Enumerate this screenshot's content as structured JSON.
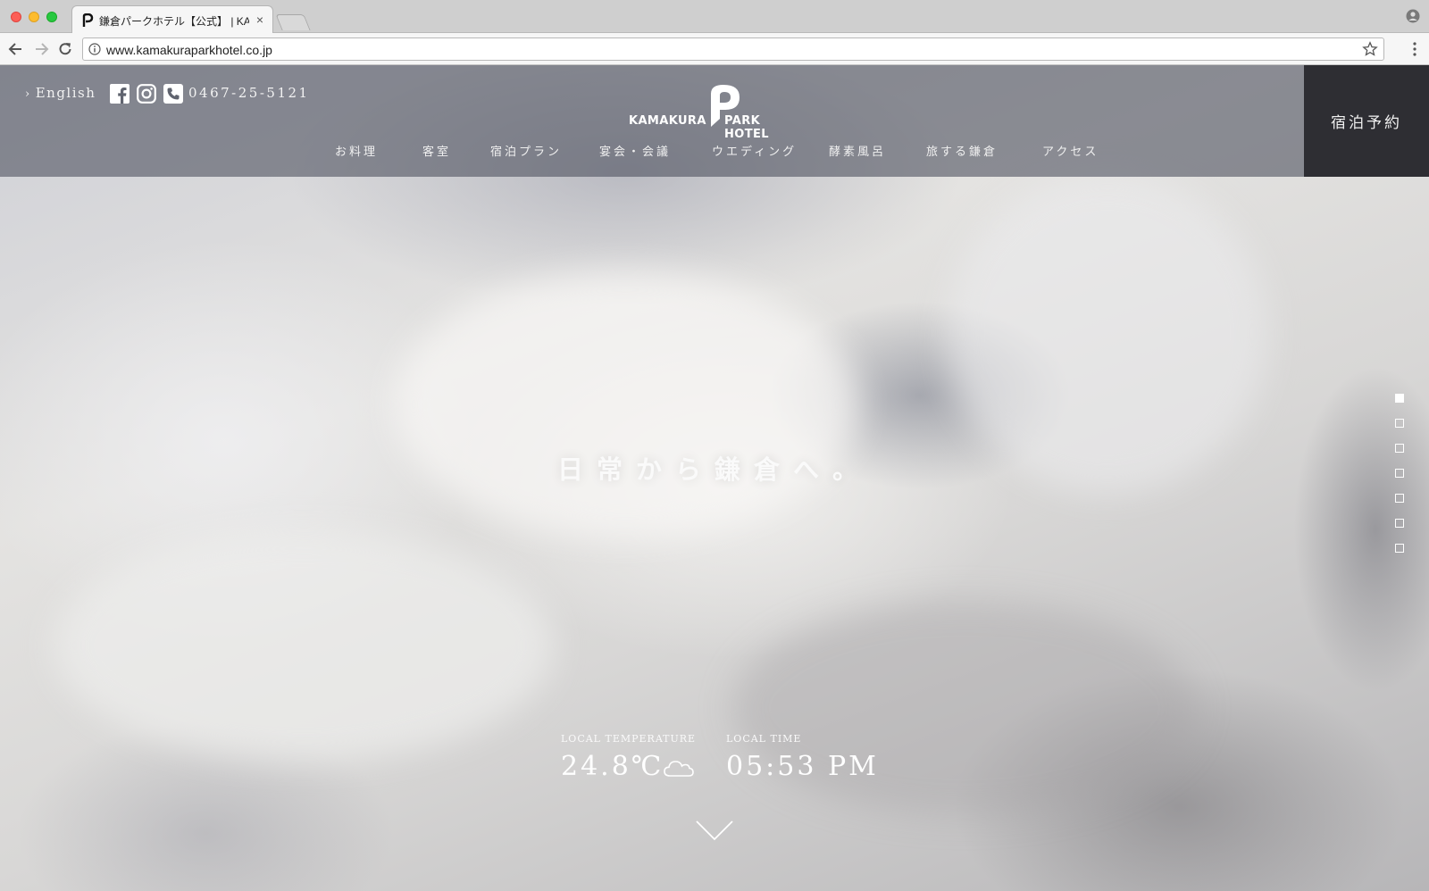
{
  "browser": {
    "tab_title": "鎌倉パークホテル【公式】 | KAMAKURA PARK HOTEL",
    "tab_close": "×",
    "url": "www.kamakuraparkhotel.co.jp",
    "icons": [
      "back-icon",
      "forward-icon",
      "reload-icon",
      "info-icon",
      "star-icon",
      "menu-icon",
      "profile-icon"
    ]
  },
  "header": {
    "language_link": "English",
    "language_chevron": "›",
    "phone": "0467-25-5121",
    "logo": {
      "left": "KAMAKURA",
      "right": "PARK HOTEL"
    },
    "reserve_label": "宿泊予約",
    "social_icons": [
      "facebook-icon",
      "instagram-icon",
      "phone-icon"
    ]
  },
  "nav": {
    "items": [
      {
        "label": "お料理"
      },
      {
        "label": "客室"
      },
      {
        "label": "宿泊プラン"
      },
      {
        "label": "宴会・会議"
      },
      {
        "label": "ウエディング"
      },
      {
        "label": "酵素風呂"
      },
      {
        "label": "旅する鎌倉"
      },
      {
        "label": "アクセス"
      }
    ]
  },
  "hero": {
    "title": "日常から鎌倉へ。",
    "slides_total": 7,
    "slide_active": 1
  },
  "weather": {
    "temp_label": "LOCAL TEMPERATURE",
    "temp_value": "24.8℃",
    "condition_icon": "cloud-icon",
    "time_label": "LOCAL TIME",
    "time_value": "05:53 PM"
  },
  "colors": {
    "header_overlay": "#525662",
    "reserve_bg": "#2e2e33",
    "text_light": "#ffffff"
  }
}
